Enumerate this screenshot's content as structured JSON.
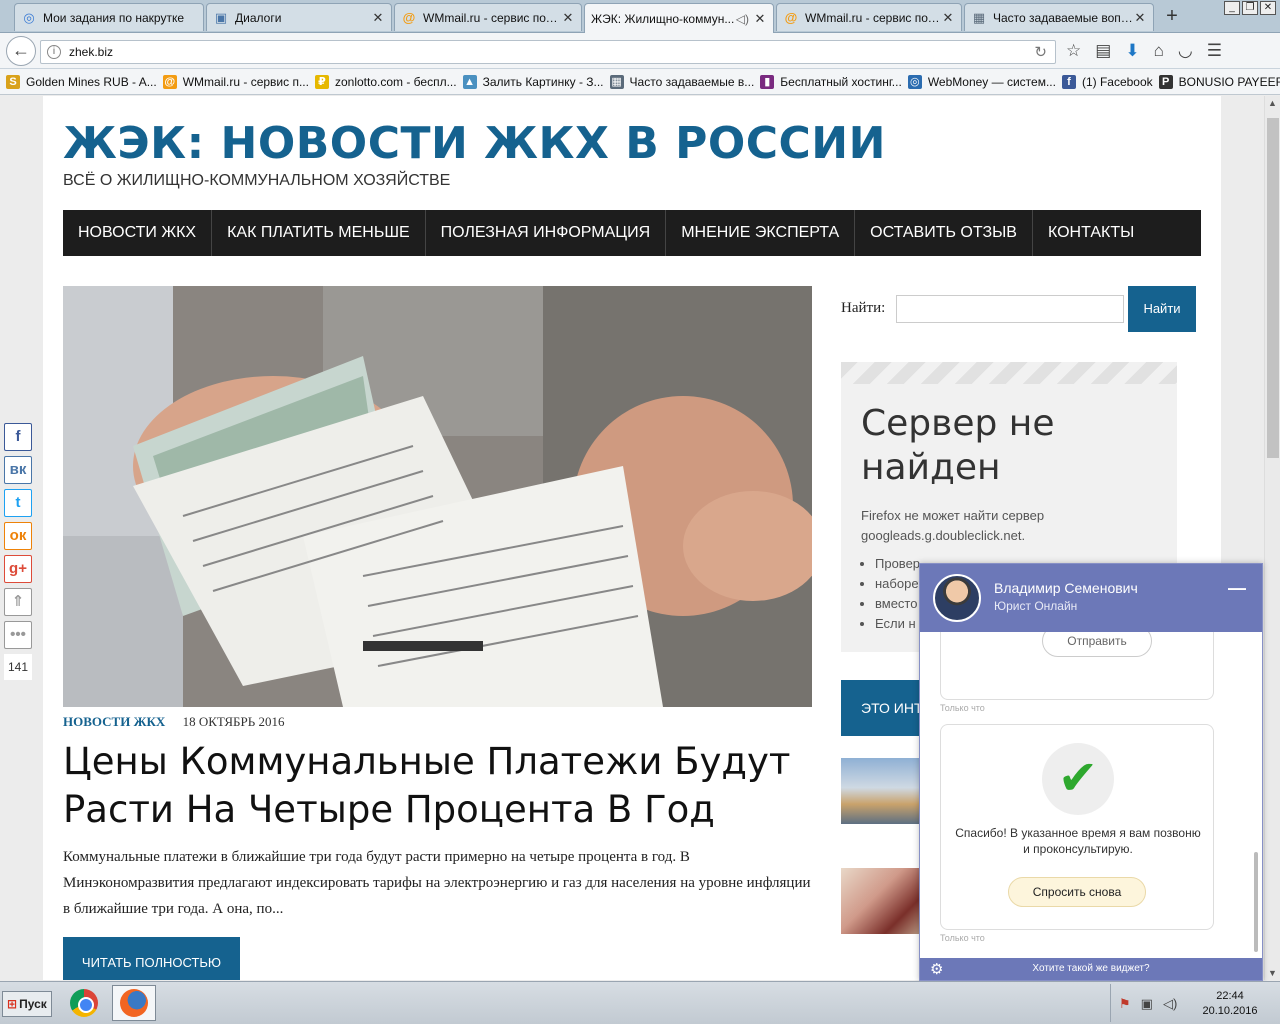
{
  "browser": {
    "tabs": [
      {
        "title": "Мои задания по накрутке",
        "icon": "vk-target-icon"
      },
      {
        "title": "Диалоги",
        "icon": "vk-icon"
      },
      {
        "title": "WMmail.ru - сервис почт...",
        "icon": "wmmail-icon"
      },
      {
        "title": "ЖЭК: Жилищно-коммун...",
        "icon": "zhek-icon",
        "active": true
      },
      {
        "title": "WMmail.ru - сервис почт...",
        "icon": "wmmail-icon"
      },
      {
        "title": "Часто задаваемые вопр...",
        "icon": "faq-icon"
      }
    ],
    "url": "zhek.biz",
    "bookmarks": [
      {
        "label": "Golden Mines RUB - A...",
        "icon": "S",
        "color": "#d9a21b"
      },
      {
        "label": "WMmail.ru - сервис п...",
        "icon": "@",
        "color": "#f39c12"
      },
      {
        "label": "zonlotto.com - беспл...",
        "icon": "₽",
        "color": "#e6b800"
      },
      {
        "label": "Залить Картинку - З...",
        "icon": "▲",
        "color": "#4a90c0"
      },
      {
        "label": "Часто задаваемые в...",
        "icon": "▦",
        "color": "#5a6a7a"
      },
      {
        "label": "Бесплатный хостинг...",
        "icon": "▮",
        "color": "#7a2a80"
      },
      {
        "label": "WebMoney — систем...",
        "icon": "◎",
        "color": "#2b6cb0"
      },
      {
        "label": "(1) Facebook",
        "icon": "f",
        "color": "#3b5998"
      },
      {
        "label": "BONUSIO PAYEER BO...",
        "icon": "P",
        "color": "#333333"
      }
    ]
  },
  "site": {
    "title": "ЖЭК: НОВОСТИ ЖКХ В РОССИИ",
    "subtitle": "ВСЁ О ЖИЛИЩНО-КОММУНАЛЬНОМ ХОЗЯЙСТВЕ",
    "nav": [
      "НОВОСТИ ЖКХ",
      "КАК ПЛАТИТЬ МЕНЬШЕ",
      "ПОЛЕЗНАЯ ИНФОРМАЦИЯ",
      "МНЕНИЕ ЭКСПЕРТА",
      "ОСТАВИТЬ ОТЗЫВ",
      "КОНТАКТЫ"
    ]
  },
  "post": {
    "category": "НОВОСТИ ЖКХ",
    "date": "18 ОКТЯБРЬ 2016",
    "title": "Цены Коммунальные Платежи Будут Расти На Четыре Процента В Год",
    "excerpt": "Коммунальные платежи в ближайшие три года будут расти примерно на четыре процента в год. В Минэкономразвития предлагают индексировать тарифы на электроэнергию и газ для населения на уровне инфляции в ближайшие три года. А она, по...",
    "read_more": "ЧИТАТЬ ПОЛНОСТЬЮ"
  },
  "sidebar": {
    "search_label": "Найти:",
    "search_value": "",
    "search_button": "Найти",
    "error_title": "Сервер не найден",
    "error_text": "Firefox не может найти сервер googleads.g.doubleclick.net.",
    "error_items": [
      "Провер",
      "наборе",
      "вместо",
      "Если н"
    ],
    "widget_title": "ЭТО ИНТ"
  },
  "share": {
    "buttons": [
      {
        "label": "f",
        "color": "#3b5998",
        "icon": "facebook-icon"
      },
      {
        "label": "вк",
        "color": "#4a76a8",
        "icon": "vk-icon"
      },
      {
        "label": "t",
        "color": "#1da1f2",
        "icon": "twitter-icon"
      },
      {
        "label": "ок",
        "color": "#ee8208",
        "icon": "odnoklassniki-icon"
      },
      {
        "label": "g+",
        "color": "#dd4b39",
        "icon": "google-plus-icon"
      },
      {
        "label": "⇑",
        "color": "#999999",
        "icon": "scroll-up-icon"
      },
      {
        "label": "•••",
        "color": "#999999",
        "icon": "more-icon"
      }
    ],
    "count": "141"
  },
  "chat": {
    "agent_name": "Владимир Семенович",
    "agent_role": "Юрист Онлайн",
    "send_button": "Отправить",
    "stamp1": "Только что",
    "thanks": "Спасибо! В указанное время я вам позвоню и проконсультирую.",
    "ask_again": "Спросить снова",
    "stamp2": "Только что",
    "promo": "Хотите такой же виджет?"
  },
  "taskbar": {
    "start": "Пуск",
    "time": "22:44",
    "date": "20.10.2016"
  }
}
